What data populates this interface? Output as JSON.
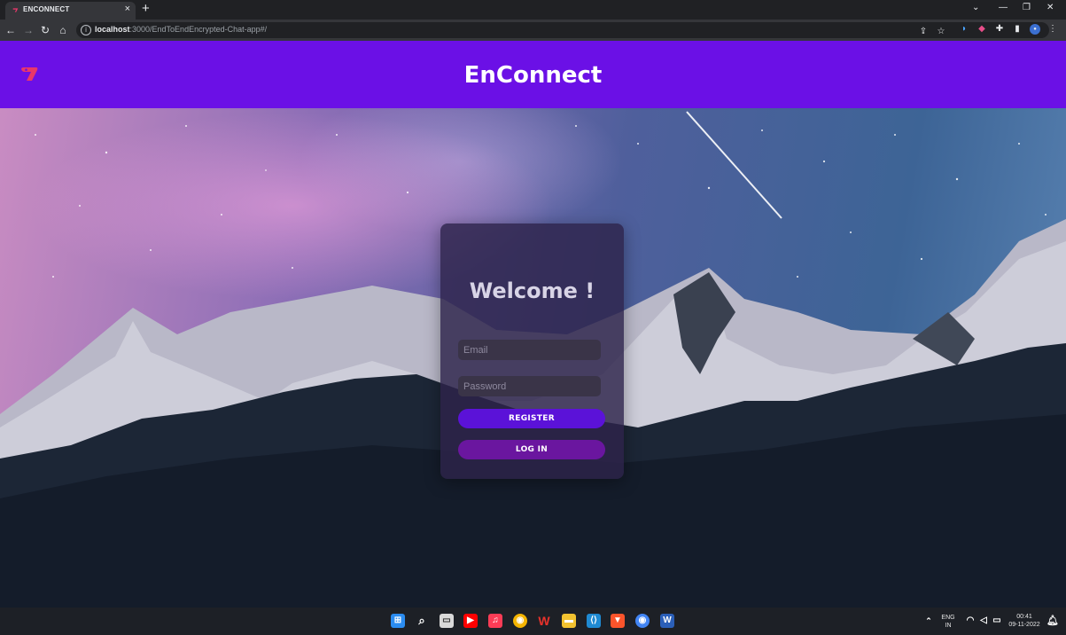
{
  "browser": {
    "tab_title": "ENCONNECT",
    "tab_close": "×",
    "new_tab": "+",
    "url_host": "localhost",
    "url_rest": ":3000/EndToEndEncrypted-Chat-app#/"
  },
  "header": {
    "title": "EnConnect",
    "brand_color": "#6b10e6"
  },
  "login": {
    "heading": "Welcome !",
    "email_placeholder": "Email",
    "password_placeholder": "Password",
    "register_label": "REGISTER",
    "login_label": "LOG IN"
  },
  "taskbar": {
    "lang_line1": "ENG",
    "lang_line2": "IN",
    "time": "00:41",
    "date": "09-11-2022"
  }
}
